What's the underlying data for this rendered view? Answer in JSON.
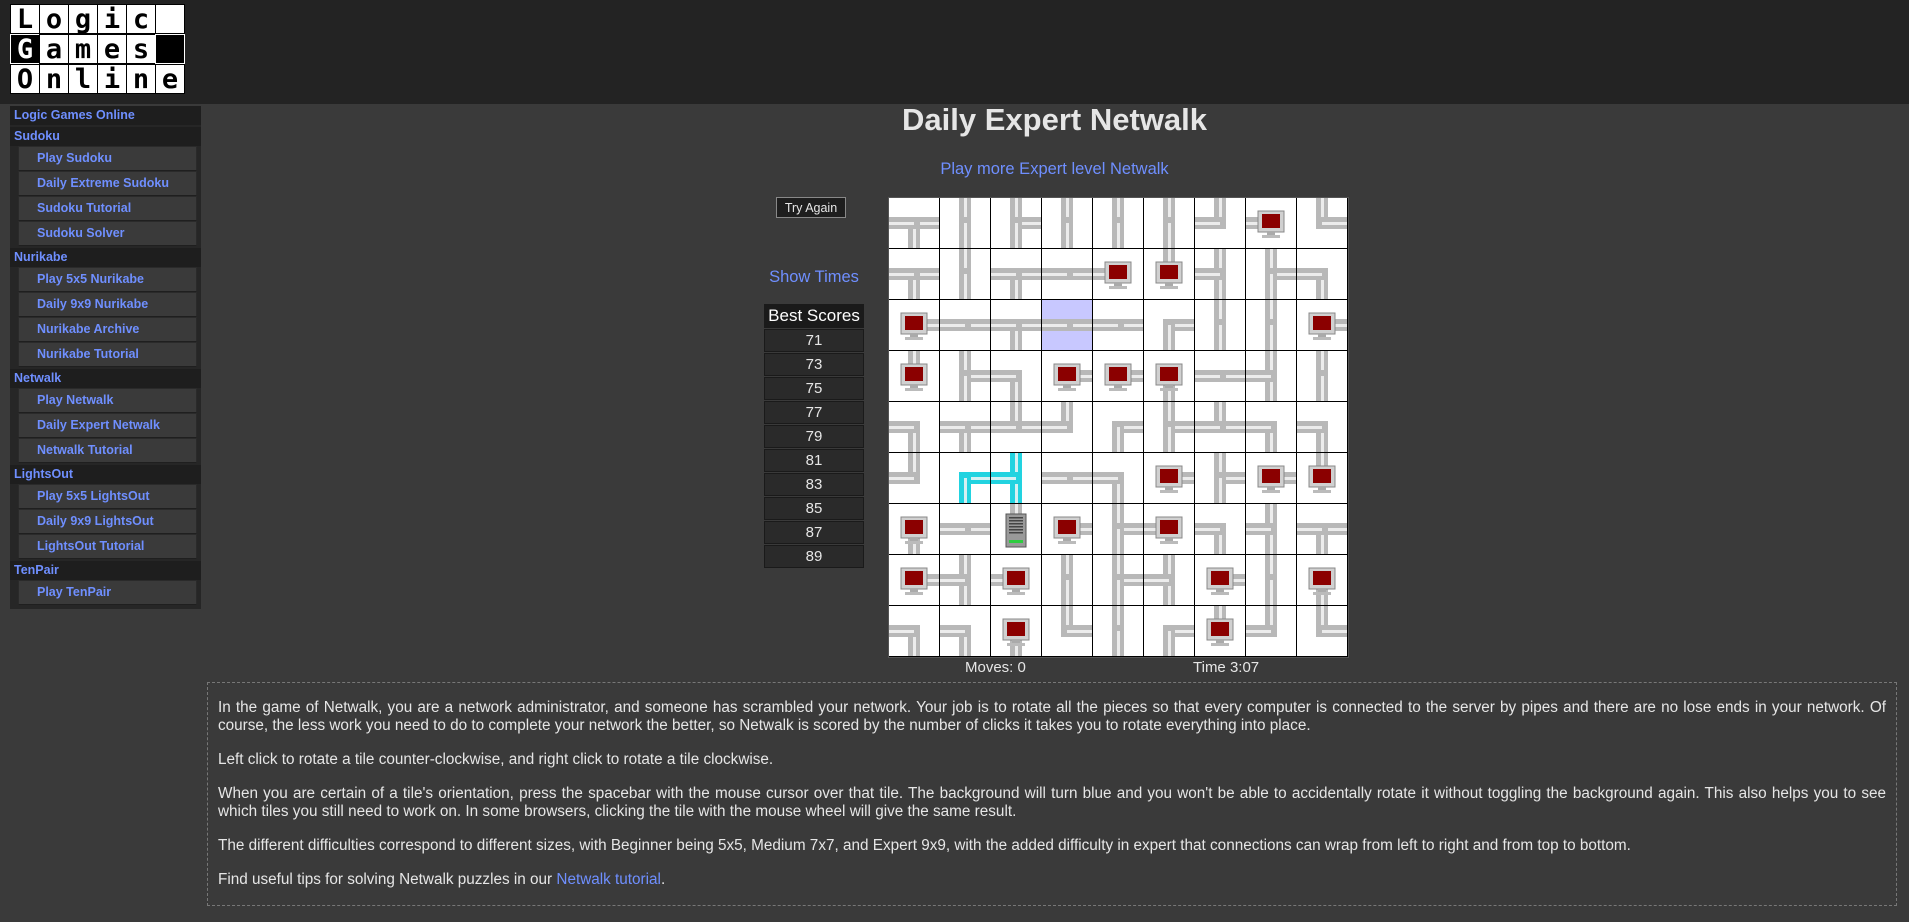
{
  "logo": {
    "rows": [
      [
        {
          "ch": "L",
          "dark": false
        },
        {
          "ch": "o",
          "dark": false
        },
        {
          "ch": "g",
          "dark": false
        },
        {
          "ch": "i",
          "dark": false
        },
        {
          "ch": "c",
          "dark": false
        },
        {
          "ch": "",
          "dark": false
        }
      ],
      [
        {
          "ch": "G",
          "dark": true
        },
        {
          "ch": "a",
          "dark": false
        },
        {
          "ch": "m",
          "dark": false
        },
        {
          "ch": "e",
          "dark": false
        },
        {
          "ch": "s",
          "dark": false
        },
        {
          "ch": "",
          "dark": true
        }
      ],
      [
        {
          "ch": "O",
          "dark": false
        },
        {
          "ch": "n",
          "dark": false
        },
        {
          "ch": "l",
          "dark": false
        },
        {
          "ch": "i",
          "dark": false
        },
        {
          "ch": "n",
          "dark": false
        },
        {
          "ch": "e",
          "dark": false
        }
      ]
    ]
  },
  "nav": {
    "home": "Logic Games Online",
    "groups": [
      {
        "title": "Sudoku",
        "items": [
          "Play Sudoku",
          "Daily Extreme Sudoku",
          "Sudoku Tutorial",
          "Sudoku Solver"
        ]
      },
      {
        "title": "Nurikabe",
        "items": [
          "Play 5x5 Nurikabe",
          "Daily 9x9 Nurikabe",
          "Nurikabe Archive",
          "Nurikabe Tutorial"
        ]
      },
      {
        "title": "Netwalk",
        "items": [
          "Play Netwalk",
          "Daily Expert Netwalk",
          "Netwalk Tutorial"
        ]
      },
      {
        "title": "LightsOut",
        "items": [
          "Play 5x5 LightsOut",
          "Daily 9x9 LightsOut",
          "LightsOut Tutorial"
        ]
      },
      {
        "title": "TenPair",
        "items": [
          "Play TenPair"
        ]
      }
    ]
  },
  "page": {
    "title": "Daily Expert Netwalk",
    "more_link": "Play more Expert level Netwalk",
    "try_again": "Try Again",
    "show_times": "Show Times",
    "scores_header": "Best Scores",
    "scores": [
      "71",
      "73",
      "75",
      "77",
      "79",
      "81",
      "83",
      "85",
      "87",
      "89"
    ],
    "moves": "Moves: 0",
    "time": "Time 3:07"
  },
  "board": {
    "size": 9,
    "selected": [
      2,
      3
    ],
    "tiles": [
      [
        {
          "c": "ESW",
          "t": "pipe"
        },
        {
          "c": "NS",
          "t": "pipe"
        },
        {
          "c": "NES",
          "t": "pipe"
        },
        {
          "c": "NS",
          "t": "pipe"
        },
        {
          "c": "NS",
          "t": "pipe"
        },
        {
          "c": "NS",
          "t": "pipe"
        },
        {
          "c": "NW",
          "t": "pipe"
        },
        {
          "c": "W",
          "t": "computer"
        },
        {
          "c": "NE",
          "t": "pipe"
        }
      ],
      [
        {
          "c": "ESW",
          "t": "pipe"
        },
        {
          "c": "NS",
          "t": "pipe"
        },
        {
          "c": "ESW",
          "t": "pipe"
        },
        {
          "c": "EW",
          "t": "pipe"
        },
        {
          "c": "W",
          "t": "computer"
        },
        {
          "c": "N",
          "t": "computer"
        },
        {
          "c": "NSW",
          "t": "pipe"
        },
        {
          "c": "NES",
          "t": "pipe"
        },
        {
          "c": "SW",
          "t": "pipe"
        }
      ],
      [
        {
          "c": "E",
          "t": "computer"
        },
        {
          "c": "EW",
          "t": "pipe"
        },
        {
          "c": "ESW",
          "t": "pipe"
        },
        {
          "c": "EW",
          "t": "pipe"
        },
        {
          "c": "EW",
          "t": "pipe"
        },
        {
          "c": "ES",
          "t": "pipe"
        },
        {
          "c": "NS",
          "t": "pipe"
        },
        {
          "c": "NS",
          "t": "pipe"
        },
        {
          "c": "E",
          "t": "computer"
        }
      ],
      [
        {
          "c": "N",
          "t": "computer"
        },
        {
          "c": "NES",
          "t": "pipe"
        },
        {
          "c": "SW",
          "t": "pipe"
        },
        {
          "c": "E",
          "t": "computer"
        },
        {
          "c": "E",
          "t": "computer"
        },
        {
          "c": "S",
          "t": "computer"
        },
        {
          "c": "EW",
          "t": "pipe"
        },
        {
          "c": "NSW",
          "t": "pipe"
        },
        {
          "c": "NS",
          "t": "pipe"
        }
      ],
      [
        {
          "c": "SW",
          "t": "pipe"
        },
        {
          "c": "ESW",
          "t": "pipe"
        },
        {
          "c": "NEW",
          "t": "pipe"
        },
        {
          "c": "NW",
          "t": "pipe"
        },
        {
          "c": "ES",
          "t": "pipe"
        },
        {
          "c": "NES",
          "t": "pipe"
        },
        {
          "c": "NEW",
          "t": "pipe"
        },
        {
          "c": "SW",
          "t": "pipe"
        },
        {
          "c": "SW",
          "t": "pipe"
        }
      ],
      [
        {
          "c": "NW",
          "t": "pipe"
        },
        {
          "c": "ES",
          "t": "pipe",
          "a": true
        },
        {
          "c": "NSW",
          "t": "pipe",
          "a": true
        },
        {
          "c": "EW",
          "t": "pipe"
        },
        {
          "c": "SW",
          "t": "pipe"
        },
        {
          "c": "E",
          "t": "computer"
        },
        {
          "c": "NES",
          "t": "pipe"
        },
        {
          "c": "E",
          "t": "computer"
        },
        {
          "c": "N",
          "t": "computer"
        }
      ],
      [
        {
          "c": "S",
          "t": "computer"
        },
        {
          "c": "EW",
          "t": "pipe"
        },
        {
          "c": "N",
          "t": "server"
        },
        {
          "c": "E",
          "t": "computer"
        },
        {
          "c": "NES",
          "t": "pipe"
        },
        {
          "c": "W",
          "t": "computer"
        },
        {
          "c": "SW",
          "t": "pipe"
        },
        {
          "c": "NSW",
          "t": "pipe"
        },
        {
          "c": "ESW",
          "t": "pipe"
        }
      ],
      [
        {
          "c": "E",
          "t": "computer"
        },
        {
          "c": "NSW",
          "t": "pipe"
        },
        {
          "c": "W",
          "t": "computer"
        },
        {
          "c": "NS",
          "t": "pipe"
        },
        {
          "c": "NES",
          "t": "pipe"
        },
        {
          "c": "NSW",
          "t": "pipe"
        },
        {
          "c": "E",
          "t": "computer"
        },
        {
          "c": "NS",
          "t": "pipe"
        },
        {
          "c": "S",
          "t": "computer"
        }
      ],
      [
        {
          "c": "SW",
          "t": "pipe"
        },
        {
          "c": "SW",
          "t": "pipe"
        },
        {
          "c": "S",
          "t": "computer"
        },
        {
          "c": "NE",
          "t": "pipe"
        },
        {
          "c": "NS",
          "t": "pipe"
        },
        {
          "c": "ES",
          "t": "pipe"
        },
        {
          "c": "N",
          "t": "computer"
        },
        {
          "c": "NW",
          "t": "pipe"
        },
        {
          "c": "NE",
          "t": "pipe"
        }
      ]
    ]
  },
  "description": {
    "p1": "In the game of Netwalk, you are a network administrator, and someone has scrambled your network. Your job is to rotate all the pieces so that every computer is connected to the server by pipes and there are no lose ends in your network. Of course, the less work you need to do to complete your network the better, so Netwalk is scored by the number of clicks it takes you to rotate everything into place.",
    "p2": "Left click to rotate a tile counter-clockwise, and right click to rotate a tile clockwise.",
    "p3": "When you are certain of a tile's orientation, press the spacebar with the mouse cursor over that tile. The background will turn blue and you won't be able to accidentally rotate it without toggling the background again. This also helps you to see which tiles you still need to work on. In some browsers, clicking the tile with the mouse wheel will give the same result.",
    "p4": "The different difficulties correspond to different sizes, with Beginner being 5x5, Medium 7x7, and Expert 9x9, with the added difficulty in expert that connections can wrap from left to right and from top to bottom.",
    "p5_prefix": "Find useful tips for solving Netwalk puzzles in our ",
    "p5_link": "Netwalk tutorial",
    "p5_suffix": "."
  },
  "colors": {
    "link": "#6f8fff",
    "pipe": "#b8b8b8",
    "active_pipe": "#22d3e0",
    "monitor_screen": "#8b0000",
    "selected_tile": "#c8c8ff"
  }
}
